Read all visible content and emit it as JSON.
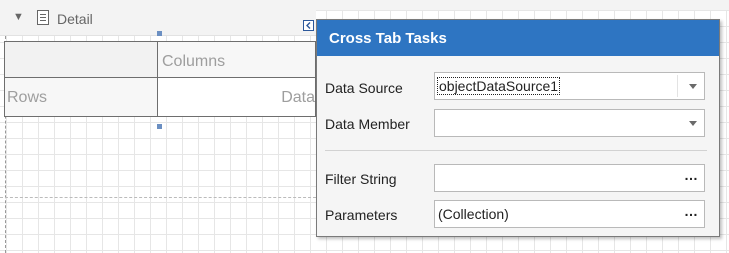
{
  "band": {
    "title": "Detail",
    "toggle_glyph": "▼",
    "icon": "band-detail-icon"
  },
  "crosstab": {
    "columns_label": "Columns",
    "rows_label": "Rows",
    "data_label": "Data"
  },
  "smart_tag": {
    "icon": "smart-tag-arrow-icon"
  },
  "tasks": {
    "title": "Cross Tab Tasks",
    "fields": {
      "data_source": {
        "label": "Data Source",
        "value": "objectDataSource1",
        "button": "dropdown-arrow-icon"
      },
      "data_member": {
        "label": "Data Member",
        "value": "",
        "button": "dropdown-arrow-icon"
      },
      "filter_string": {
        "label": "Filter String",
        "value": "",
        "button": "…"
      },
      "parameters": {
        "label": "Parameters",
        "value": "(Collection)",
        "button": "…"
      }
    }
  },
  "colors": {
    "header_blue": "#2e75c2",
    "handle_blue": "#6b8fc2",
    "cell_text": "#9e9e9e"
  }
}
